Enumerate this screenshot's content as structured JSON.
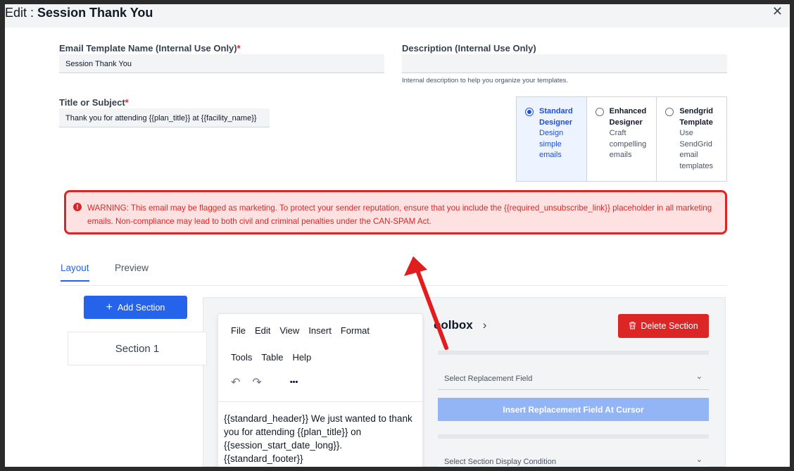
{
  "window": {
    "title_prefix": "Edit : ",
    "title_name": "Session Thank You",
    "close_glyph": "✕"
  },
  "form": {
    "template_name": {
      "label": "Email Template Name (Internal Use Only)",
      "required_mark": "*",
      "value": "Session Thank You"
    },
    "description": {
      "label": "Description (Internal Use Only)",
      "value": "",
      "hint": "Internal description to help you organize your templates."
    },
    "subject": {
      "label": "Title or Subject",
      "required_mark": "*",
      "value": "Thank you for attending {{plan_title}} at {{facility_name}}"
    }
  },
  "designer_options": [
    {
      "title": "Standard Designer",
      "desc": "Design simple emails",
      "selected": true
    },
    {
      "title": "Enhanced Designer",
      "desc": "Craft compelling emails",
      "selected": false
    },
    {
      "title": "Sendgrid Template",
      "desc": "Use SendGrid email templates",
      "selected": false
    }
  ],
  "warning": {
    "icon": "!",
    "text": "WARNING: This email may be flagged as marketing. To protect your sender reputation, ensure that you include the {{required_unsubscribe_link}} placeholder in all marketing emails. Non-compliance may lead to both civil and criminal penalties under the CAN-SPAM Act."
  },
  "tabs": [
    {
      "label": "Layout",
      "active": true
    },
    {
      "label": "Preview",
      "active": false
    }
  ],
  "sections": {
    "add_label": "Add Section",
    "add_glyph": "+",
    "items": [
      "Section 1"
    ]
  },
  "editor": {
    "menu_row1": [
      "File",
      "Edit",
      "View",
      "Insert",
      "Format"
    ],
    "menu_row2": [
      "Tools",
      "Table",
      "Help"
    ],
    "undo_glyph": "↶",
    "redo_glyph": "↷",
    "more_glyph": "•••",
    "body": "{{standard_header}} We just wanted to thank you for attending {{plan_title}} on {{session_start_date_long}}. {{standard_footer}}"
  },
  "toolbox": {
    "title": "oolbox",
    "chevron": "›",
    "delete_label": "Delete Section",
    "replacement_placeholder": "Select Replacement Field",
    "insert_label": "Insert Replacement Field At Cursor",
    "condition_placeholder": "Select Section Display Condition",
    "select_chevron": "⌄"
  },
  "colors": {
    "accent": "#2563eb",
    "danger": "#dc2626",
    "warning_bg": "#fee2e2"
  }
}
